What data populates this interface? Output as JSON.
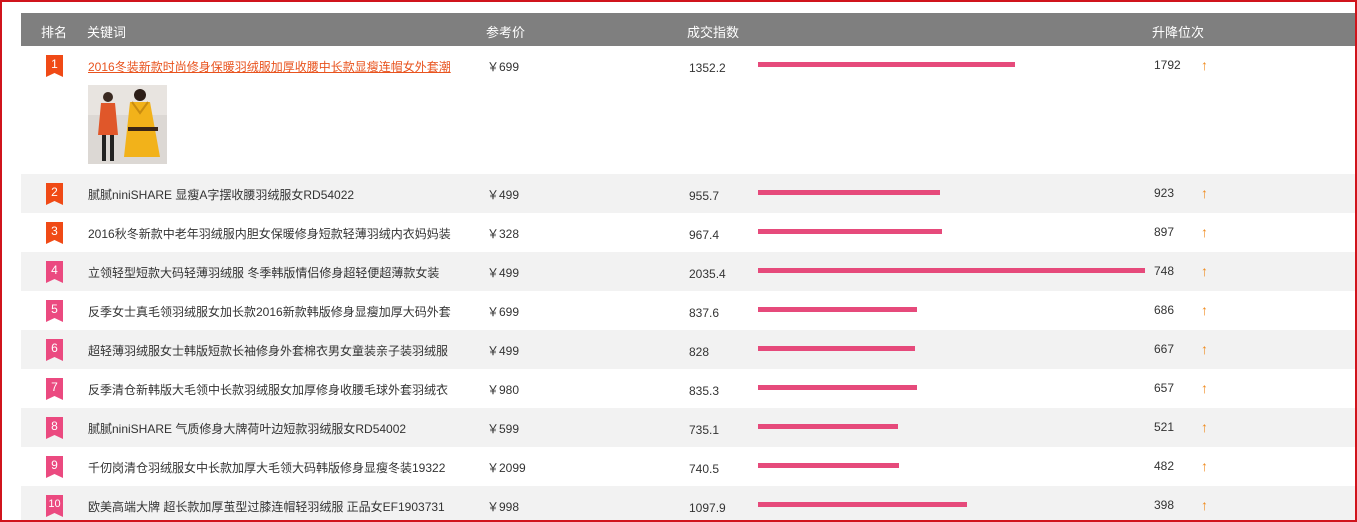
{
  "header": {
    "rank": "排名",
    "keyword": "关键词",
    "price": "参考价",
    "index": "成交指数",
    "change": "升降位次"
  },
  "colors": {
    "border": "#d0141c",
    "header_bg": "#7f7f7f",
    "bar": "#e64a7b",
    "top3_badge": "#f04a16",
    "other_badge": "#eb4a80",
    "first_link": "#e8531e",
    "up_arrow": "#f08a1c"
  },
  "bar_max_index": 2035.4,
  "rows": [
    {
      "rank": "1",
      "keyword": "2016冬装新款时尚修身保暖羽绒服加厚收腰中长款显瘦连帽女外套潮",
      "price": "￥699",
      "index": "1352.2",
      "index_value": 1352.2,
      "change": "1792",
      "trend": "up",
      "arrow": "↑",
      "thumb_icon": "down-jacket-thumbnail-icon"
    },
    {
      "rank": "2",
      "keyword": "腻腻niniSHARE 显瘦A字摆收腰羽绒服女RD54022",
      "price": "￥499",
      "index": "955.7",
      "index_value": 955.7,
      "change": "923",
      "trend": "up",
      "arrow": "↑"
    },
    {
      "rank": "3",
      "keyword": "2016秋冬新款中老年羽绒服内胆女保暖修身短款轻薄羽绒内衣妈妈装",
      "price": "￥328",
      "index": "967.4",
      "index_value": 967.4,
      "change": "897",
      "trend": "up",
      "arrow": "↑"
    },
    {
      "rank": "4",
      "keyword": "立领轻型短款大码轻薄羽绒服 冬季韩版情侣修身超轻便超薄款女装",
      "price": "￥499",
      "index": "2035.4",
      "index_value": 2035.4,
      "change": "748",
      "trend": "up",
      "arrow": "↑"
    },
    {
      "rank": "5",
      "keyword": "反季女士真毛领羽绒服女加长款2016新款韩版修身显瘦加厚大码外套",
      "price": "￥699",
      "index": "837.6",
      "index_value": 837.6,
      "change": "686",
      "trend": "up",
      "arrow": "↑"
    },
    {
      "rank": "6",
      "keyword": "超轻薄羽绒服女士韩版短款长袖修身外套棉衣男女童装亲子装羽绒服",
      "price": "￥499",
      "index": "828",
      "index_value": 828,
      "change": "667",
      "trend": "up",
      "arrow": "↑"
    },
    {
      "rank": "7",
      "keyword": "反季清仓新韩版大毛领中长款羽绒服女加厚修身收腰毛球外套羽绒衣",
      "price": "￥980",
      "index": "835.3",
      "index_value": 835.3,
      "change": "657",
      "trend": "up",
      "arrow": "↑"
    },
    {
      "rank": "8",
      "keyword": "腻腻niniSHARE 气质修身大牌荷叶边短款羽绒服女RD54002",
      "price": "￥599",
      "index": "735.1",
      "index_value": 735.1,
      "change": "521",
      "trend": "up",
      "arrow": "↑"
    },
    {
      "rank": "9",
      "keyword": "千仞岗清仓羽绒服女中长款加厚大毛领大码韩版修身显瘦冬装19322",
      "price": "￥2099",
      "index": "740.5",
      "index_value": 740.5,
      "change": "482",
      "trend": "up",
      "arrow": "↑"
    },
    {
      "rank": "10",
      "keyword": "欧美高端大牌 超长款加厚茧型过膝连帽轻羽绒服 正品女EF1903731",
      "price": "￥998",
      "index": "1097.9",
      "index_value": 1097.9,
      "change": "398",
      "trend": "up",
      "arrow": "↑"
    }
  ]
}
